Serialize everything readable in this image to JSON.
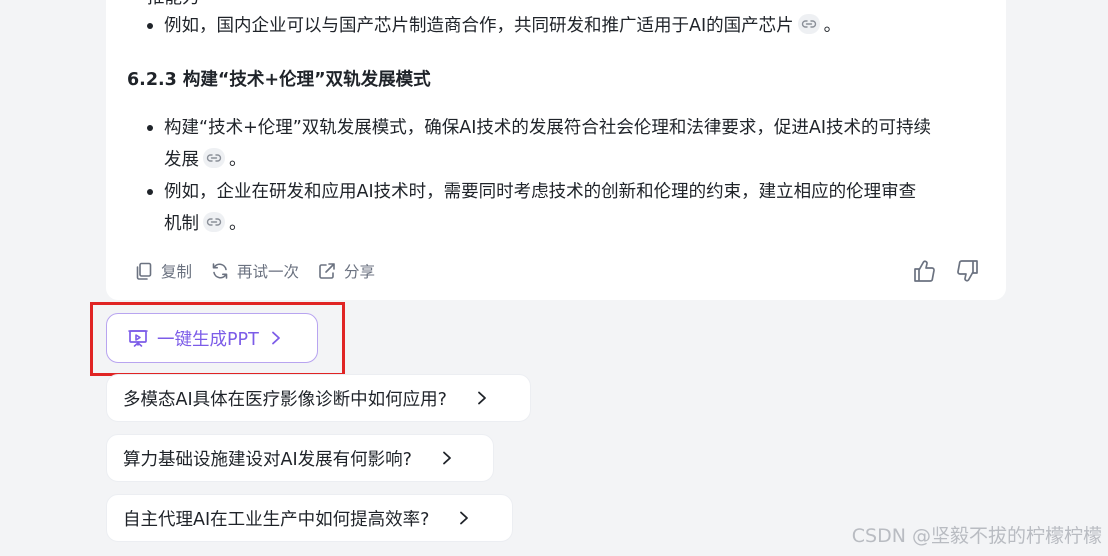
{
  "answer": {
    "top_cut_text": "推能力",
    "bullets_section1": [
      {
        "text": "例如，国内企业可以与国产芯片制造商合作，共同研发和推广适用于AI的国产芯片",
        "tail": "。"
      }
    ],
    "heading": "6.2.3 构建“技术+伦理”双轨发展模式",
    "bullets_section2": [
      {
        "line1": "构建“技术+伦理”双轨发展模式，确保AI技术的发展符合社会伦理和法律要求，促进AI技术的可持续",
        "line2": "发展",
        "tail": "。"
      },
      {
        "line1": "例如，企业在研发和应用AI技术时，需要同时考虑技术的创新和伦理的约束，建立相应的伦理审查",
        "line2": "机制",
        "tail": "。"
      }
    ],
    "actions": {
      "copy": "复制",
      "retry": "再试一次",
      "share": "分享"
    }
  },
  "ppt_button": {
    "label": "一键生成PPT"
  },
  "suggestions": [
    {
      "label": "多模态AI具体在医疗影像诊断中如何应用?"
    },
    {
      "label": "算力基础设施建设对AI发展有何影响?"
    },
    {
      "label": "自主代理AI在工业生产中如何提高效率?"
    }
  ],
  "watermark": "CSDN @坚毅不拔的柠檬柠檬",
  "colors": {
    "accent_purple": "#7c5ce8",
    "highlight_red": "#e02424",
    "background": "#f3f4f6"
  }
}
